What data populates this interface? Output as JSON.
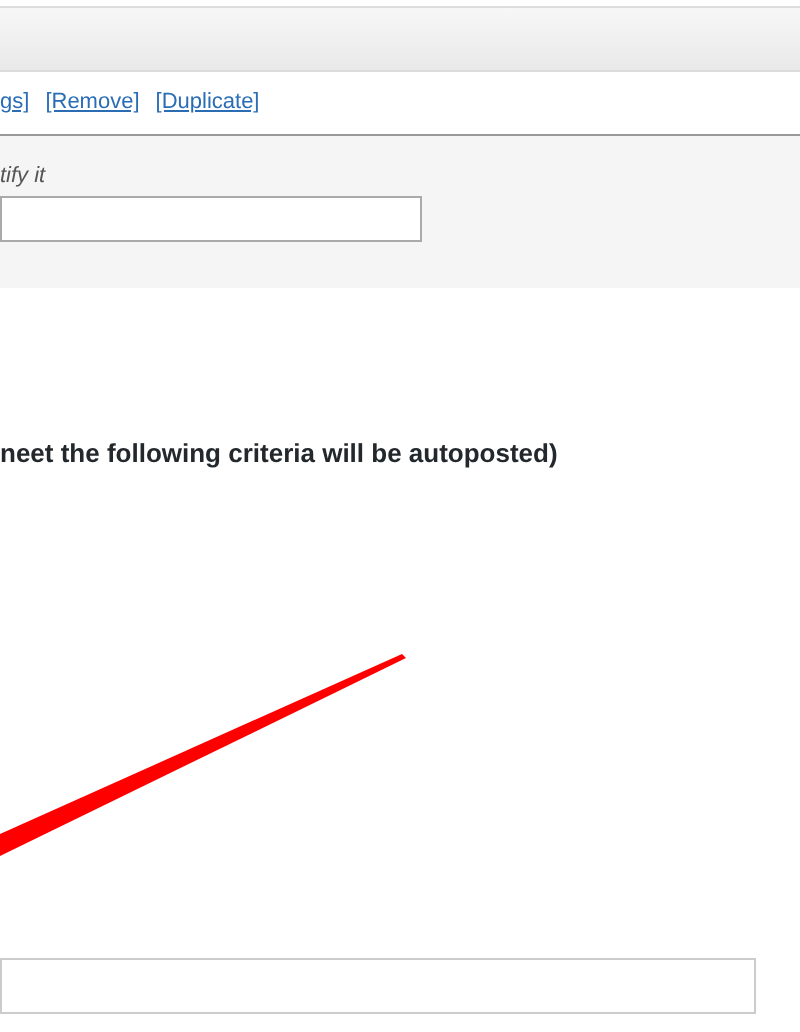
{
  "links": [
    "gs]",
    "[Remove]",
    "[Duplicate]"
  ],
  "panel": {
    "label": "tify it"
  },
  "criteria_heading": "neet the following criteria will be autoposted)"
}
